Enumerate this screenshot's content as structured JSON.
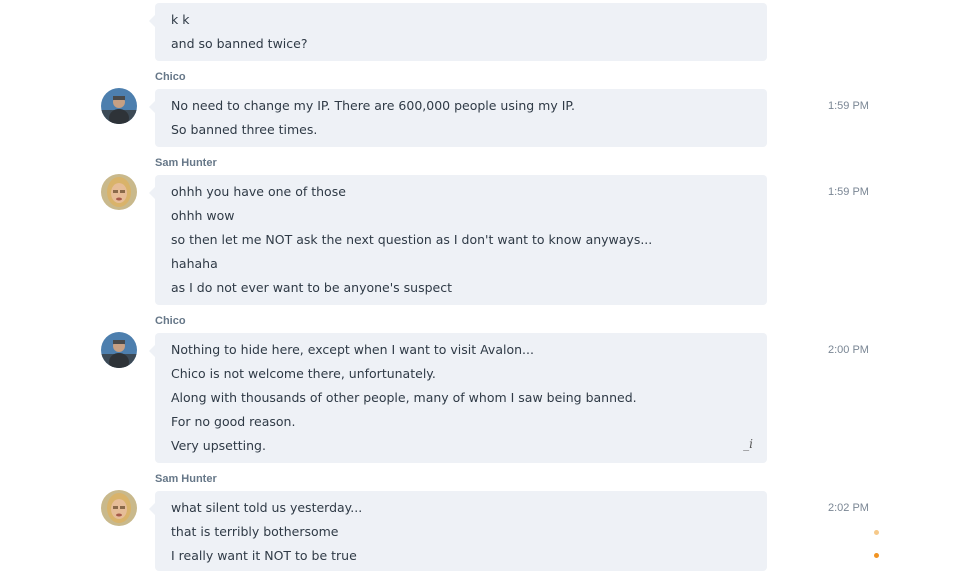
{
  "colors": {
    "bubble": "#eef1f6",
    "sender": "#667788",
    "time": "#7a8694",
    "dot_light": "#f6c98a",
    "dot_dark": "#f29422"
  },
  "groups": [
    {
      "lines": [
        "k k",
        "and so banned twice?"
      ]
    },
    {
      "sender": "Chico",
      "time": "1:59 PM",
      "avatar": "chico-avatar",
      "lines": [
        "No need to change my IP.  There are 600,000 people using my IP.",
        "So banned three times."
      ]
    },
    {
      "sender": "Sam Hunter",
      "time": "1:59 PM",
      "avatar": "sam-avatar",
      "lines": [
        "ohhh you have one of those",
        "ohhh wow",
        "so then let me NOT ask the next question as I don't want to know anyways...",
        "hahaha",
        "as I do not ever want to be anyone's suspect"
      ]
    },
    {
      "sender": "Chico",
      "time": "2:00 PM",
      "avatar": "chico-avatar",
      "lines": [
        "Nothing to hide here, except when I want to visit Avalon...",
        "Chico is not welcome there, unfortunately.",
        "Along with thousands of other people, many of whom I saw being banned.",
        "For no good reason.",
        "Very upsetting."
      ],
      "edit_icon": "_i"
    },
    {
      "sender": "Sam Hunter",
      "time": "2:02 PM",
      "avatar": "sam-avatar",
      "lines": [
        "what silent told us yesterday...",
        "that is terribly bothersome",
        "I really want it NOT to be true"
      ]
    }
  ]
}
